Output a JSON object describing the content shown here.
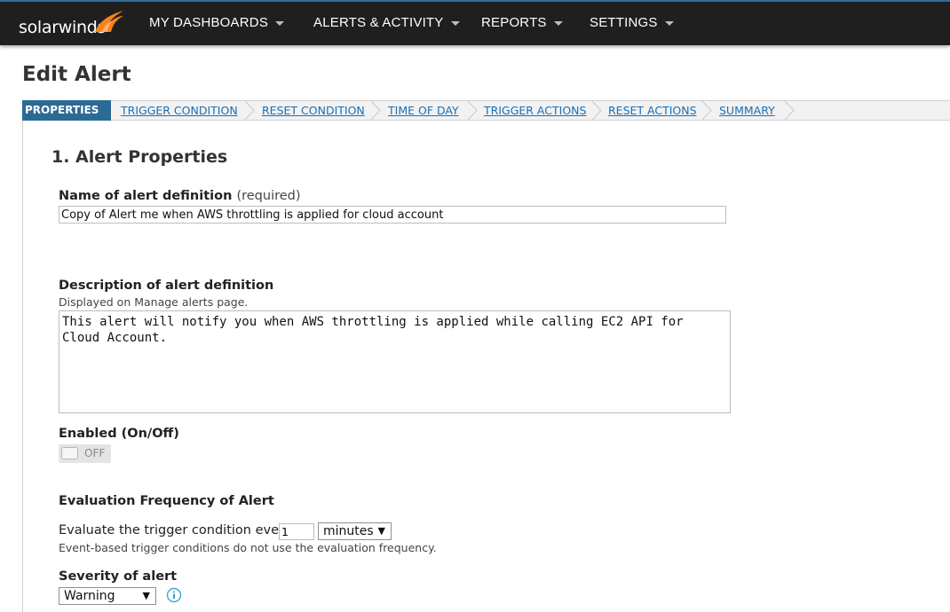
{
  "brand": {
    "logo_text": "solarwinds"
  },
  "nav": {
    "items": [
      {
        "label": "MY DASHBOARDS"
      },
      {
        "label": "ALERTS & ACTIVITY"
      },
      {
        "label": "REPORTS"
      },
      {
        "label": "SETTINGS"
      }
    ]
  },
  "page": {
    "title": "Edit Alert"
  },
  "wizard": {
    "active": "PROPERTIES",
    "steps": [
      "TRIGGER CONDITION",
      "RESET CONDITION",
      "TIME OF DAY",
      "TRIGGER ACTIONS",
      "RESET ACTIONS",
      "SUMMARY"
    ]
  },
  "form": {
    "section_title": "1. Alert Properties",
    "name": {
      "label": "Name of alert definition",
      "note": "(required)",
      "value": "Copy of Alert me when AWS throttling is applied for cloud account"
    },
    "description": {
      "label": "Description of alert definition",
      "hint": "Displayed on Manage alerts page.",
      "value": "This alert will notify you when AWS throttling is applied while calling EC2 API for Cloud Account."
    },
    "enabled": {
      "label": "Enabled (On/Off)",
      "state": "OFF"
    },
    "evaluation": {
      "heading": "Evaluation Frequency of Alert",
      "text": "Evaluate the trigger condition every",
      "value": "1",
      "unit": "minutes",
      "hint": "Event-based trigger conditions do not use the evaluation frequency."
    },
    "severity": {
      "label": "Severity of alert",
      "value": "Warning"
    }
  },
  "colors": {
    "topbar": "#1f1f1f",
    "active_step": "#2c6a96",
    "link": "#1a6fb5",
    "logo_flame": "#f5841f",
    "info_icon": "#3da3d6"
  },
  "icons": {
    "select_arrow": "▼"
  }
}
